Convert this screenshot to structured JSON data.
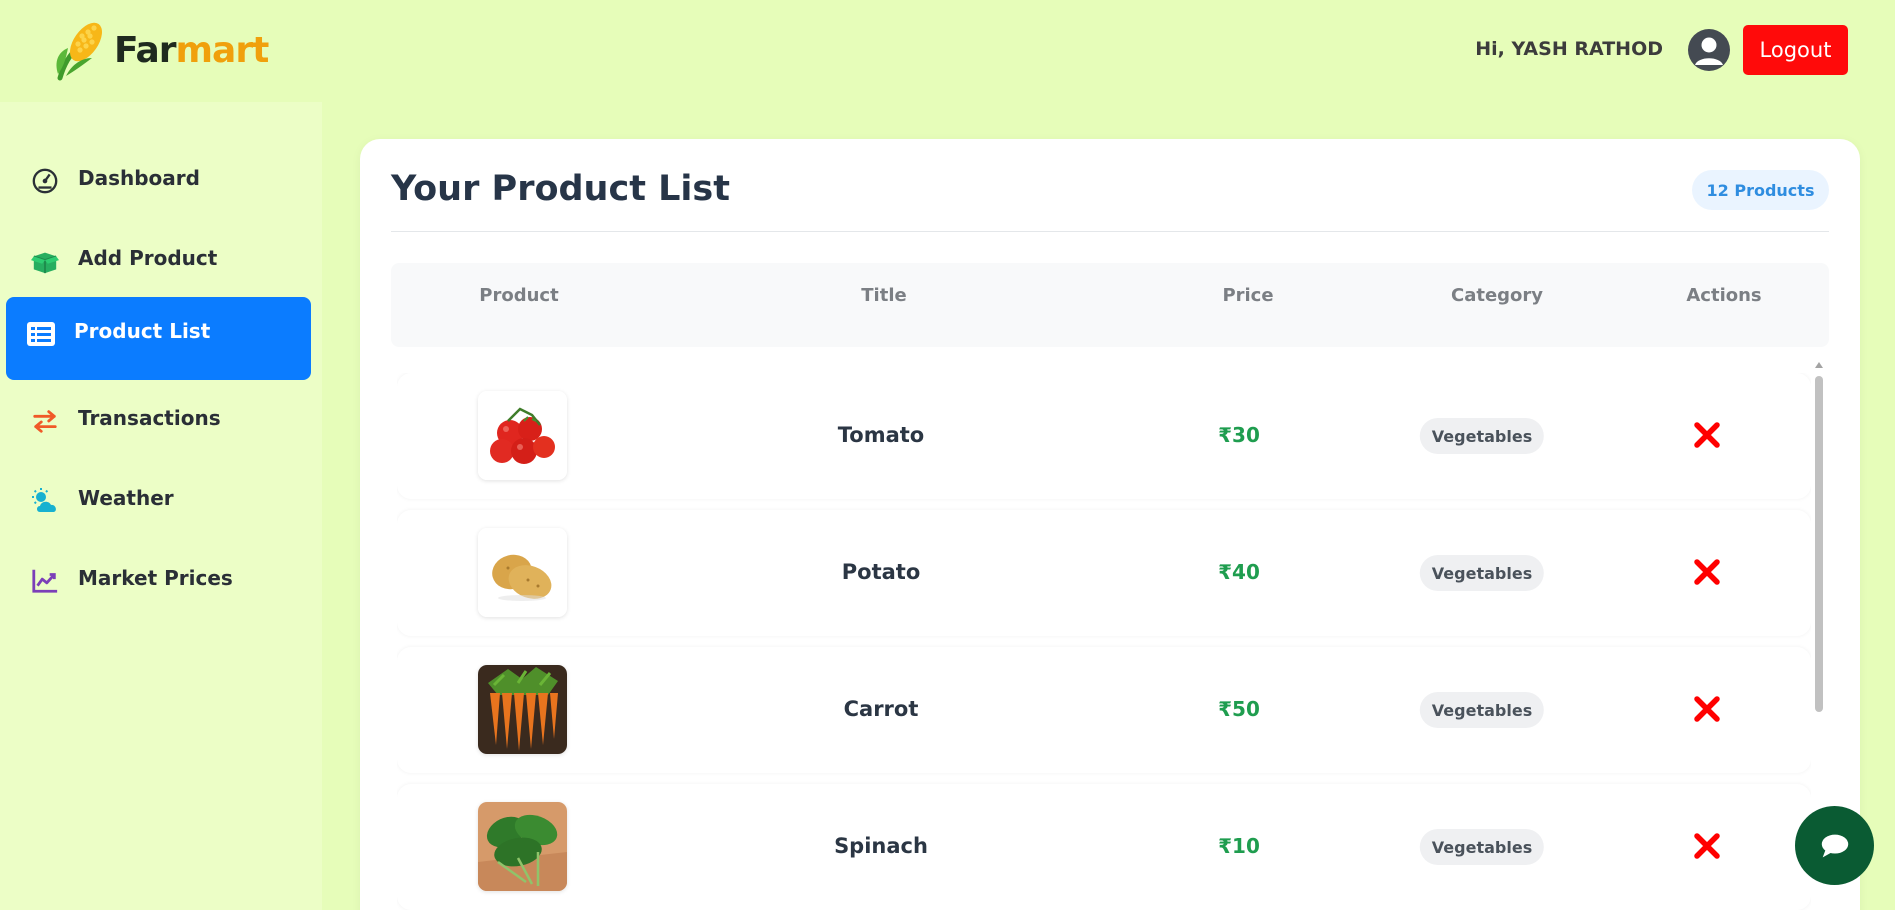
{
  "header": {
    "logo_far": "Far",
    "logo_mart": "mart",
    "greeting": "Hi, YASH RATHOD",
    "logout_label": "Logout"
  },
  "sidebar": {
    "items": [
      {
        "label": "Dashboard",
        "icon": "dashboard-icon",
        "active": false
      },
      {
        "label": "Add Product",
        "icon": "box-icon",
        "active": false
      },
      {
        "label": "Product List",
        "icon": "list-icon",
        "active": true
      },
      {
        "label": "Transactions",
        "icon": "exchange-icon",
        "active": false
      },
      {
        "label": "Weather",
        "icon": "weather-icon",
        "active": false
      },
      {
        "label": "Market Prices",
        "icon": "chart-line-icon",
        "active": false
      }
    ]
  },
  "main": {
    "title": "Your Product List",
    "count_badge": "12 Products",
    "columns": [
      "Product",
      "Title",
      "Price",
      "Category",
      "Actions"
    ],
    "products": [
      {
        "title": "Tomato",
        "price": "₹30",
        "category": "Vegetables",
        "image": "tomato"
      },
      {
        "title": "Potato",
        "price": "₹40",
        "category": "Vegetables",
        "image": "potato"
      },
      {
        "title": "Carrot",
        "price": "₹50",
        "category": "Vegetables",
        "image": "carrot"
      },
      {
        "title": "Spinach",
        "price": "₹10",
        "category": "Vegetables",
        "image": "spinach"
      }
    ]
  },
  "colors": {
    "background": "#e6fdb9",
    "sidebar": "#ecfec6",
    "active_nav": "#0b7cff",
    "logout": "#ff0a0a",
    "price": "#1f9d4f",
    "delete": "#ff0000",
    "chat": "#0a5b33"
  }
}
